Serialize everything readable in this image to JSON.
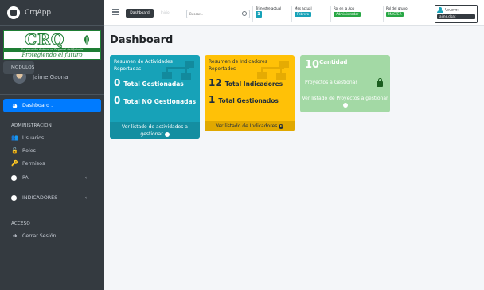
{
  "brand": {
    "name": "CrqApp"
  },
  "logo": {
    "letters": "CRQ",
    "band": "Corporación Autónoma Regional del Quindío",
    "motto": "Protegiendo el futuro"
  },
  "user": {
    "name": "Jaime Gaona"
  },
  "nav": {
    "dashboard": "Dashboard .",
    "admin_header": "ADMINISTRACIÓN",
    "usuarios": "Usuarios",
    "roles": "Roles",
    "permisos": "Permisos",
    "modulos_header": "MÓDULOS",
    "pai": "PAI",
    "indicadores": "INDICADORES",
    "acceso_header": "ACCESO",
    "cerrar": "Cerrar Sesión"
  },
  "navbar": {
    "dashboard_btn": "Dashboard",
    "faded_link": "Inicio",
    "search_placeholder": "Buscar...",
    "trimestre_label": "Trimestre actual",
    "trimestre_value": "1",
    "mes_label": "Mes actual",
    "mes_value": "Febrero",
    "rol_label": "Rol en la App",
    "rol_value": "Administrador",
    "grupo_label": "Rol del grupo",
    "grupo_value": "MASTER",
    "usuario_label": "Usuario:",
    "usuario_value": "jaime.dbat"
  },
  "page": {
    "title": "Dashboard"
  },
  "cards": {
    "actividades": {
      "title": "Resumen de Actividades Reportadas",
      "n1": "0",
      "l1": "Total Gestionadas",
      "n2": "0",
      "l2": "Total NO Gestionadas",
      "footer": "Ver listado de actividades a gestionar"
    },
    "indicadores": {
      "title": "Resumen de Indicadores Reportados",
      "n1": "12",
      "l1": "Total Indicadores",
      "n2": "1",
      "l2": "Total Gestionados",
      "footer": "Ver listado de Indicadores"
    },
    "proyectos": {
      "count": "10",
      "count_label": "Cantidad",
      "subtitle": "Proyectos a Gestionar",
      "footer": "Ver listado de Proyectos a gestionar"
    }
  },
  "colors": {
    "sidebar": "#343a40",
    "active": "#007bff",
    "info": "#17a2b8",
    "warning": "#ffc107",
    "success": "#a3d9a5"
  }
}
